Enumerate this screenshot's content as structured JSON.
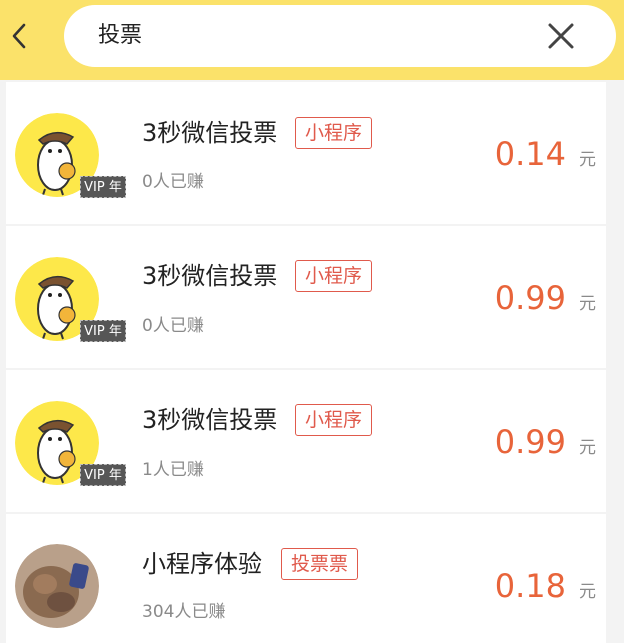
{
  "search": {
    "query": "投票"
  },
  "items": [
    {
      "title": "3秒微信投票",
      "tag": "小程序",
      "earned": "0人已赚",
      "price": "0.14",
      "unit": "元",
      "vip_label": "VIP 年",
      "avatar": "mascot-avatar"
    },
    {
      "title": "3秒微信投票",
      "tag": "小程序",
      "earned": "0人已赚",
      "price": "0.99",
      "unit": "元",
      "vip_label": "VIP 年",
      "avatar": "mascot-avatar"
    },
    {
      "title": "3秒微信投票",
      "tag": "小程序",
      "earned": "1人已赚",
      "price": "0.99",
      "unit": "元",
      "vip_label": "VIP 年",
      "avatar": "mascot-avatar"
    },
    {
      "title": "小程序体验",
      "tag": "投票票",
      "earned": "304人已赚",
      "price": "0.18",
      "unit": "元",
      "avatar": "photo-avatar"
    }
  ],
  "colors": {
    "header_bg": "#fbe26a",
    "price": "#e8643a",
    "tag": "#e05a4c"
  }
}
